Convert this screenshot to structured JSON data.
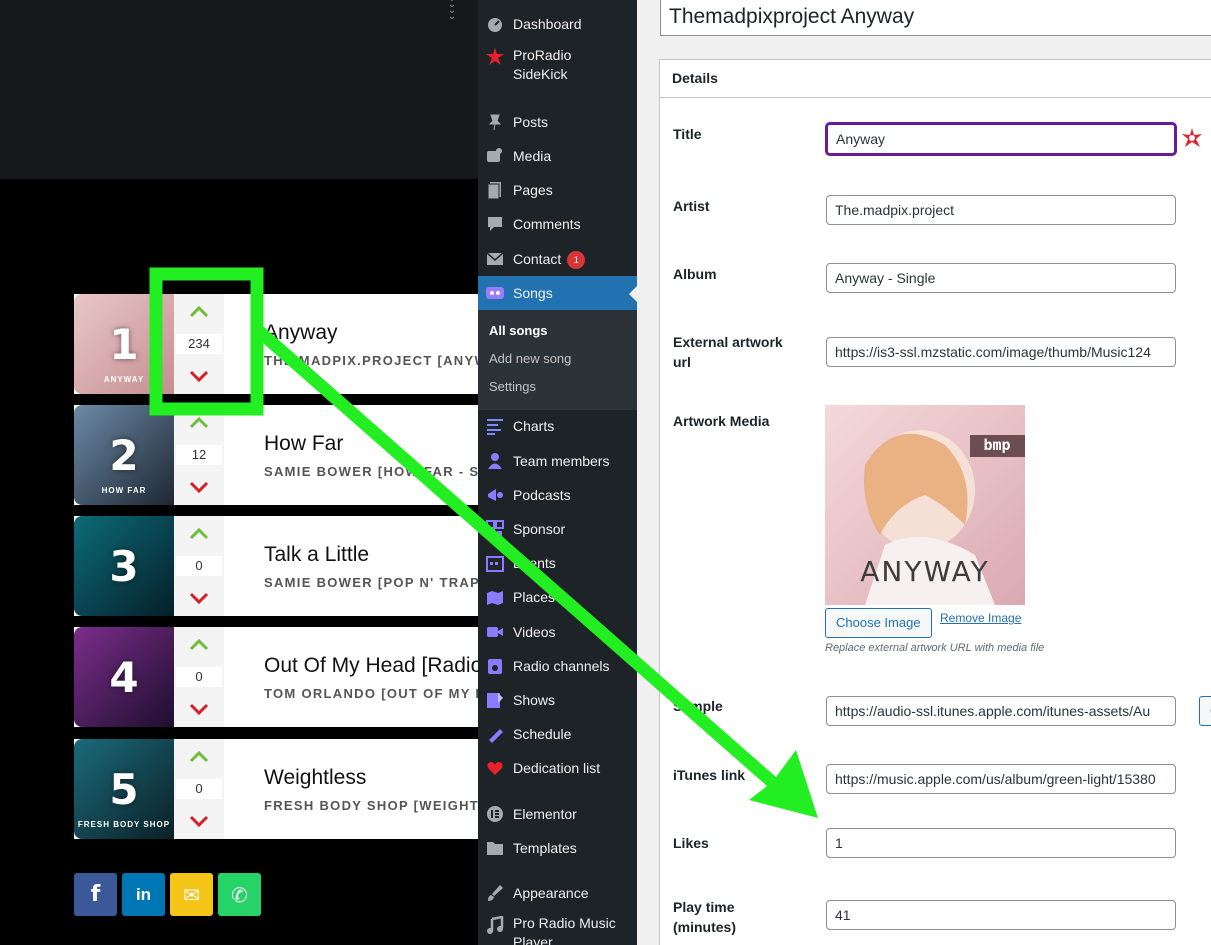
{
  "front": {
    "chart": [
      {
        "rank": "1",
        "votes": "234",
        "title": "Anyway",
        "subtitle": "THE.MADPIX.PROJECT [ANYWAY - SINGLE]",
        "thumb_text": "ANYWAY",
        "thumb_colors": [
          "#e9c7c9",
          "#c58e91"
        ]
      },
      {
        "rank": "2",
        "votes": "12",
        "title": "How Far",
        "subtitle": "SAMIE BOWER [HOW FAR - SINGLE]",
        "thumb_text": "HOW FAR",
        "thumb_colors": [
          "#6c8aa6",
          "#1e2733"
        ]
      },
      {
        "rank": "3",
        "votes": "0",
        "title": "Talk a Little",
        "subtitle": "SAMIE BOWER [POP N' TRAP]",
        "thumb_text": "",
        "thumb_colors": [
          "#0c6b78",
          "#051f29"
        ]
      },
      {
        "rank": "4",
        "votes": "0",
        "title": "Out Of My Head [Radio Edit]",
        "subtitle": "TOM ORLANDO [OUT OF MY HEAD]",
        "thumb_text": "",
        "thumb_colors": [
          "#7b2d8b",
          "#1d0f2e"
        ]
      },
      {
        "rank": "5",
        "votes": "0",
        "title": "Weightless",
        "subtitle": "FRESH BODY SHOP [WEIGHTLESS]",
        "thumb_text": "FRESH BODY SHOP",
        "thumb_colors": [
          "#1b6a7a",
          "#0b2026"
        ]
      }
    ],
    "share": {
      "facebook": {
        "glyph": "f",
        "color": "#3b5998"
      },
      "linkedin": {
        "glyph": "in",
        "color": "#0077b5"
      },
      "email": {
        "glyph": "✉",
        "color": "#f5c518"
      },
      "whatsapp": {
        "glyph": "✆",
        "color": "#25d366"
      }
    }
  },
  "menu": {
    "items": [
      {
        "label": "Dashboard",
        "icon": "dashboard-icon"
      },
      {
        "label": "ProRadio SideKick",
        "icon": "proradio-star-icon"
      },
      {
        "label": "Posts",
        "icon": "pin-icon"
      },
      {
        "label": "Media",
        "icon": "media-icon"
      },
      {
        "label": "Pages",
        "icon": "pages-icon"
      },
      {
        "label": "Comments",
        "icon": "comment-icon"
      },
      {
        "label": "Contact",
        "icon": "mail-icon",
        "badge": "1"
      },
      {
        "label": "Songs",
        "icon": "songs-icon"
      },
      {
        "label": "Charts",
        "icon": "charts-icon"
      },
      {
        "label": "Team members",
        "icon": "team-icon"
      },
      {
        "label": "Podcasts",
        "icon": "podcast-icon"
      },
      {
        "label": "Sponsor",
        "icon": "sponsor-icon"
      },
      {
        "label": "Events",
        "icon": "events-icon"
      },
      {
        "label": "Places",
        "icon": "places-icon"
      },
      {
        "label": "Videos",
        "icon": "video-icon"
      },
      {
        "label": "Radio channels",
        "icon": "radio-icon"
      },
      {
        "label": "Shows",
        "icon": "shows-icon"
      },
      {
        "label": "Schedule",
        "icon": "schedule-icon"
      },
      {
        "label": "Dedication list",
        "icon": "heart-icon"
      },
      {
        "label": "Elementor",
        "icon": "elementor-icon"
      },
      {
        "label": "Templates",
        "icon": "folder-icon"
      },
      {
        "label": "Appearance",
        "icon": "brush-icon"
      },
      {
        "label": "Pro Radio Music Player",
        "icon": "music-icon"
      }
    ],
    "submenu": [
      "All songs",
      "Add new song",
      "Settings"
    ]
  },
  "editor": {
    "post_title": "Themadpixproject Anyway",
    "section": "Details",
    "labels": {
      "title": "Title",
      "artist": "Artist",
      "album": "Album",
      "external_artwork": "External artwork url",
      "artwork_media": "Artwork Media",
      "sample": "Sample",
      "itunes": "iTunes link",
      "likes": "Likes",
      "playtime": "Play time (minutes)"
    },
    "values": {
      "title": "Anyway",
      "artist": "The.madpix.project",
      "album": "Anyway - Single",
      "external_artwork": "https://is3-ssl.mzstatic.com/image/thumb/Music124",
      "sample": "https://audio-ssl.itunes.apple.com/itunes-assets/Au",
      "itunes": "https://music.apple.com/us/album/green-light/15380",
      "likes": "1",
      "playtime": "41"
    },
    "artwork_text": "ANYWAY",
    "artwork_logo": "bmp",
    "choose_image": "Choose Image",
    "remove_image": "Remove Image",
    "hint": "Replace external artwork URL with media file",
    "choose_cut": "Cho"
  },
  "annotation": {
    "color": "#22ee22"
  }
}
